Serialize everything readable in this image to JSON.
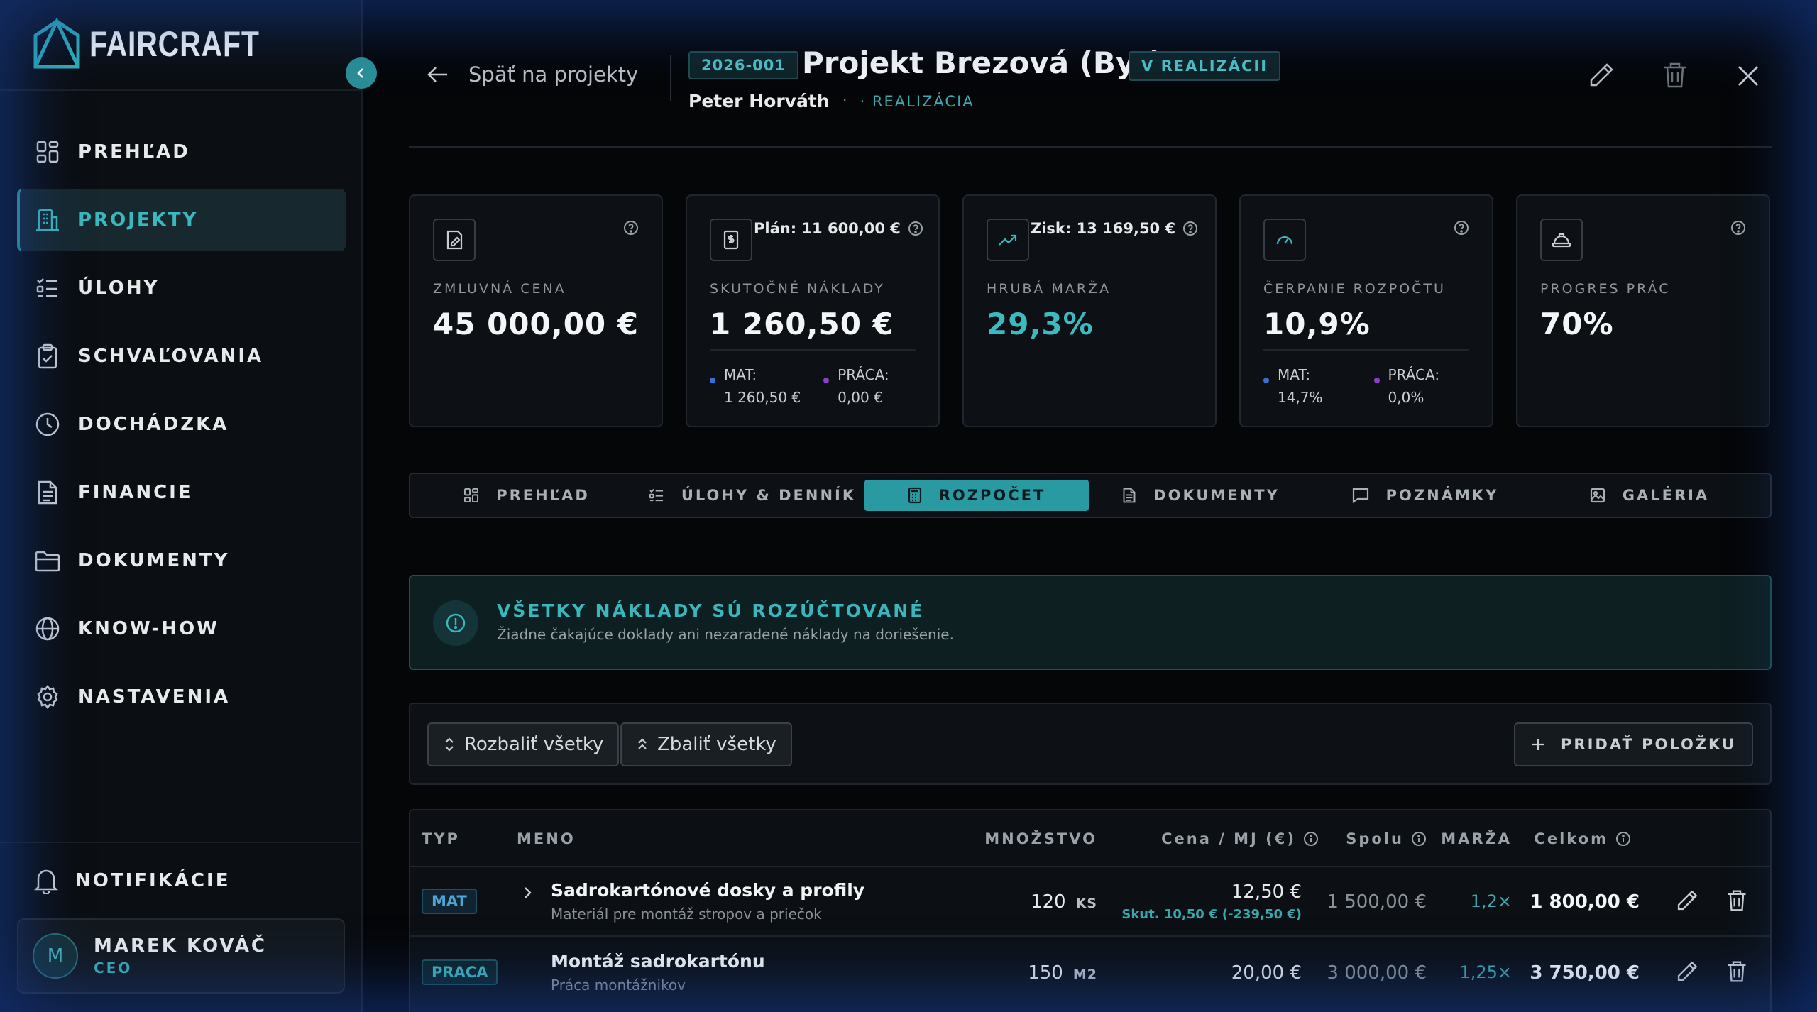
{
  "app": {
    "logo_text": "FAIRCRAFT"
  },
  "sidebar": {
    "items": [
      {
        "label": "PREHĽAD",
        "icon": "dashboard-icon",
        "active": false
      },
      {
        "label": "PROJEKTY",
        "icon": "building-icon",
        "active": true
      },
      {
        "label": "ÚLOHY",
        "icon": "checklist-icon",
        "active": false
      },
      {
        "label": "SCHVAĽOVANIA",
        "icon": "clipboard-check-icon",
        "active": false
      },
      {
        "label": "DOCHÁDZKA",
        "icon": "clock-icon",
        "active": false
      },
      {
        "label": "FINANCIE",
        "icon": "document-icon",
        "active": false
      },
      {
        "label": "DOKUMENTY",
        "icon": "folder-icon",
        "active": false
      },
      {
        "label": "KNOW-HOW",
        "icon": "globe-icon",
        "active": false
      },
      {
        "label": "NASTAVENIA",
        "icon": "gear-icon",
        "active": false
      }
    ],
    "notifications_label": "NOTIFIKÁCIE",
    "user": {
      "initial": "M",
      "name": "MAREK KOVÁČ",
      "role": "CEO"
    }
  },
  "header": {
    "back_label": "Späť na projekty",
    "project_code": "2026-001",
    "project_title": "Projekt Brezová (Byt)",
    "status": "V REALIZÁCII",
    "client": "Peter Horváth",
    "separator": "·",
    "phase": "· REALIZÁCIA"
  },
  "kpis": {
    "contract": {
      "title": "ZMLUVNÁ CENA",
      "value": "45 000,00 €"
    },
    "actual": {
      "title": "SKUTOČNÉ NÁKLADY",
      "value": "1 260,50 €",
      "plan": "Plán: 11 600,00 €",
      "mat_label": "MAT:",
      "mat_value": "1 260,50 €",
      "praca_label": "PRÁCA:",
      "praca_value": "0,00 €"
    },
    "margin": {
      "title": "HRUBÁ MARŽA",
      "value": "29,3%",
      "profit": "Zisk: 13 169,50 €"
    },
    "budget": {
      "title": "ČERPANIE ROZPOČTU",
      "value": "10,9%",
      "mat_label": "MAT:",
      "mat_value": "14,7%",
      "praca_label": "PRÁCA:",
      "praca_value": "0,0%"
    },
    "progress": {
      "title": "PROGRES PRÁC",
      "value": "70%"
    }
  },
  "tabs": [
    {
      "label": "PREHĽAD",
      "icon": "dashboard-icon"
    },
    {
      "label": "ÚLOHY & DENNÍK",
      "icon": "checklist-icon"
    },
    {
      "label": "ROZPOČET",
      "icon": "calculator-icon",
      "active": true
    },
    {
      "label": "DOKUMENTY",
      "icon": "document-icon"
    },
    {
      "label": "POZNÁMKY",
      "icon": "comment-icon"
    },
    {
      "label": "GALÉRIA",
      "icon": "image-icon"
    }
  ],
  "notice": {
    "title": "VŠETKY NÁKLADY SÚ ROZÚČTOVANÉ",
    "text": "Žiadne čakajúce doklady ani nezaradené náklady na doriešenie."
  },
  "toolbar": {
    "expand_label": "Rozbaliť všetky",
    "collapse_label": "Zbaliť všetky",
    "add_label": "PRIDAŤ POLOŽKU"
  },
  "table": {
    "headers": {
      "typ": "TYP",
      "meno": "MENO",
      "mnozstvo": "MNOŽSTVO",
      "cena": "Cena / MJ (€)",
      "spolu": "Spolu",
      "marza": "MARŽA",
      "celkom": "Celkom"
    },
    "rows": [
      {
        "type": "MAT",
        "name": "Sadrokartónové dosky a profily",
        "desc": "Materiál pre montáž stropov a priečok",
        "qty": "120",
        "unit": "KS",
        "price": "12,50 €",
        "actual": "Skut. 10,50 €  (-239,50 €)",
        "spolu": "1 500,00 €",
        "marza": "1,2×",
        "celkom": "1 800,00 €"
      },
      {
        "type": "PRACA",
        "name": "Montáž sadrokartónu",
        "desc": "Práca montážnikov",
        "qty": "150",
        "unit": "M2",
        "price": "20,00 €",
        "actual": "",
        "spolu": "3 000,00 €",
        "marza": "1,25×",
        "celkom": "3 750,00 €"
      }
    ]
  },
  "colors": {
    "accent": "#2a9aa2",
    "accent_text": "#3bb7be",
    "background": "#050608",
    "mat_dot": "#3b6fd8",
    "praca_dot": "#8a3fc9"
  }
}
